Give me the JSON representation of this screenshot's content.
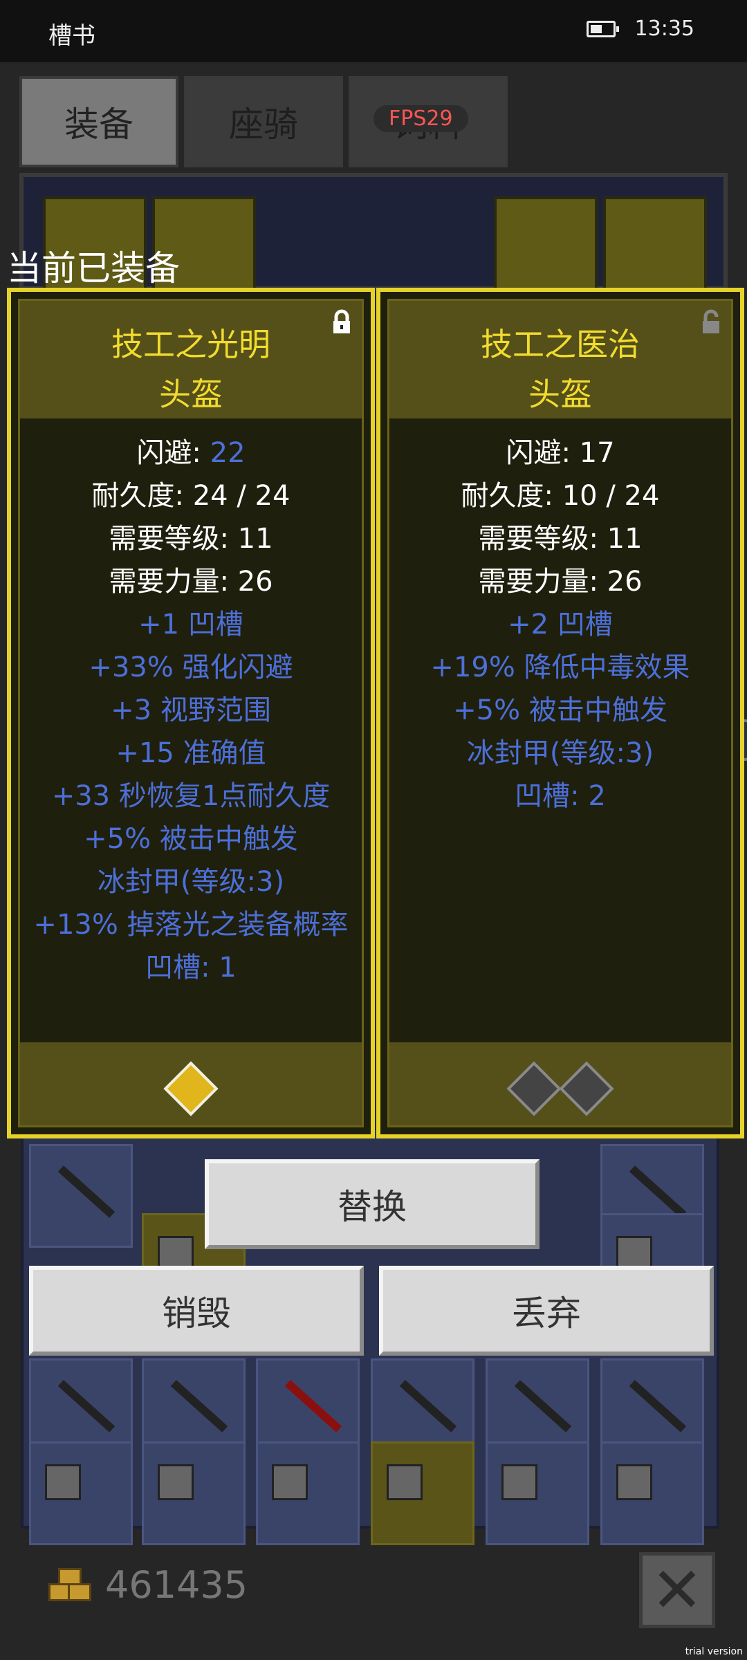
{
  "status_bar": {
    "app": "槽书",
    "time": "13:35"
  },
  "tabs": [
    {
      "label": "装备"
    },
    {
      "label": "座骑"
    },
    {
      "label": "饲料"
    }
  ],
  "fps_badge": "FPS29",
  "section_label": "当前已装备",
  "panels": [
    {
      "title": "技工之光明",
      "type": "头盔",
      "locked": true,
      "stats": [
        {
          "text": "闪避: ",
          "value": "22"
        },
        {
          "text": "耐久度: 24 / 24"
        },
        {
          "text": "需要等级: 11"
        },
        {
          "text": "需要力量: 26"
        }
      ],
      "affixes": [
        "+1 凹槽",
        "+33% 强化闪避",
        "+3 视野范围",
        "+15 准确值",
        "+33 秒恢复1点耐久度",
        "+5% 被击中触发",
        "冰封甲(等级:3)",
        "+13% 掉落光之装备概率",
        "凹槽: 1"
      ],
      "sockets": [
        "filled"
      ]
    },
    {
      "title": "技工之医治",
      "type": "头盔",
      "locked": false,
      "stats": [
        {
          "text": "闪避: 17"
        },
        {
          "text": "耐久度: 10 / 24"
        },
        {
          "text": "需要等级: 11"
        },
        {
          "text": "需要力量: 26"
        }
      ],
      "affixes": [
        "+2 凹槽",
        "+19% 降低中毒效果",
        "+5% 被击中触发",
        "冰封甲(等级:3)",
        "凹槽: 2"
      ],
      "sockets": [
        "empty",
        "empty"
      ]
    }
  ],
  "actions": {
    "replace": "替换",
    "destroy": "销毁",
    "discard": "丢弃"
  },
  "gold": "461435",
  "watermark": "trial version",
  "colors": {
    "gold_text": "#f2dc2e",
    "affix_blue": "#4c6fd8",
    "panel_border": "#e6d32a"
  }
}
